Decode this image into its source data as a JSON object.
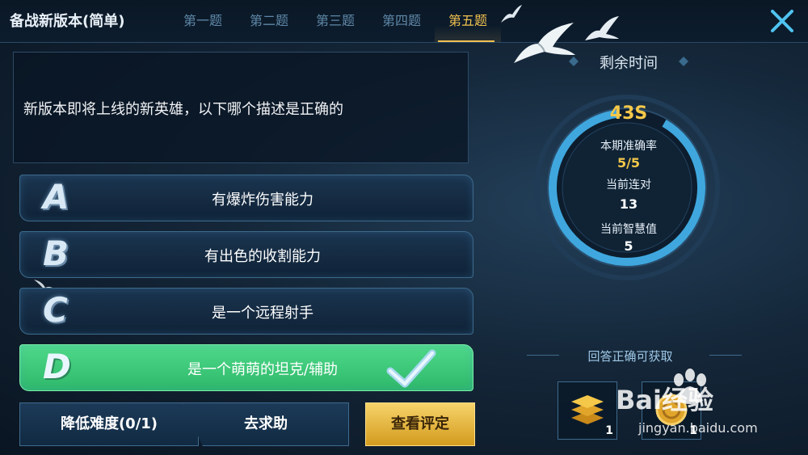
{
  "header": {
    "title": "备战新版本(简单)",
    "tabs": [
      {
        "label": "第一题",
        "active": false
      },
      {
        "label": "第二题",
        "active": false
      },
      {
        "label": "第三题",
        "active": false
      },
      {
        "label": "第四题",
        "active": false
      },
      {
        "label": "第五题",
        "active": true
      }
    ],
    "close_icon": "close-icon"
  },
  "question": {
    "text": "新版本即将上线的新英雄，以下哪个描述是正确的"
  },
  "options": [
    {
      "letter": "A",
      "label": "有爆炸伤害能力",
      "correct": false
    },
    {
      "letter": "B",
      "label": "有出色的收割能力",
      "correct": false
    },
    {
      "letter": "C",
      "label": "是一个远程射手",
      "correct": false
    },
    {
      "letter": "D",
      "label": "是一个萌萌的坦克/辅助",
      "correct": true
    }
  ],
  "buttons": {
    "lower_difficulty": "降低难度(0/1)",
    "ask_help": "去求助",
    "view_rating": "查看评定"
  },
  "timer": {
    "title": "剩余时间",
    "seconds": "43S",
    "accuracy_label": "本期准确率",
    "accuracy_value": "5/5",
    "streak_label": "当前连对",
    "streak_value": "13",
    "wisdom_label": "当前智慧值",
    "wisdom_value": "5"
  },
  "rewards": {
    "title": "回答正确可获取",
    "items": [
      {
        "icon": "stacked-coins-icon",
        "count": "1"
      },
      {
        "icon": "gold-coin-icon",
        "count": "1"
      }
    ]
  },
  "watermark": {
    "brand": "Bai经验",
    "url": "jingyan.baidu.com"
  },
  "colors": {
    "accent_gold": "#f5c84a",
    "correct_green": "#3fcf7d",
    "panel_border": "#3d6a8c"
  }
}
